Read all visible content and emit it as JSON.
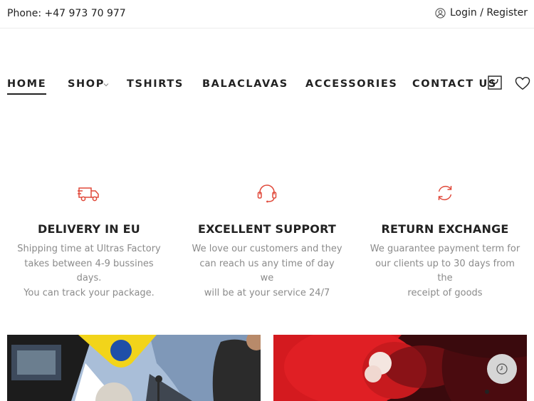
{
  "topbar": {
    "phone": "Phone: +47 973 70 977",
    "login_register": "Login / Register",
    "user_icon": "user-circle-icon"
  },
  "nav": {
    "items": [
      {
        "label": "HOME",
        "active": true
      },
      {
        "label": "SHOP",
        "has_dropdown": true
      },
      {
        "label": "TSHIRTS"
      },
      {
        "label": "BALACLAVAS"
      },
      {
        "label": "ACCESSORIES"
      },
      {
        "label": "CONTACT US"
      }
    ],
    "icons": [
      "shopping-bag-icon",
      "heart-icon"
    ]
  },
  "features": [
    {
      "icon": "delivery-truck-icon",
      "title": "DELIVERY IN EU",
      "lines": [
        "Shipping time at Ultras Factory",
        "takes between 4-9 bussines days.",
        "You can track your package."
      ]
    },
    {
      "icon": "headset-icon",
      "title": "EXCELLENT SUPPORT",
      "lines": [
        "We love our customers and they",
        "can reach us any time of day we",
        "will be at your service 24/7"
      ]
    },
    {
      "icon": "refresh-icon",
      "title": "RETURN EXCHANGE",
      "lines": [
        "We guarantee payment term for",
        "our clients up to 30 days from the",
        "receipt of goods"
      ]
    }
  ],
  "banners": [
    "banner-tshirts-photo",
    "banner-red-smoke-photo"
  ],
  "colors": {
    "accent_red": "#e0493a",
    "text_dark": "#222222",
    "text_muted": "#8b8b8b"
  }
}
